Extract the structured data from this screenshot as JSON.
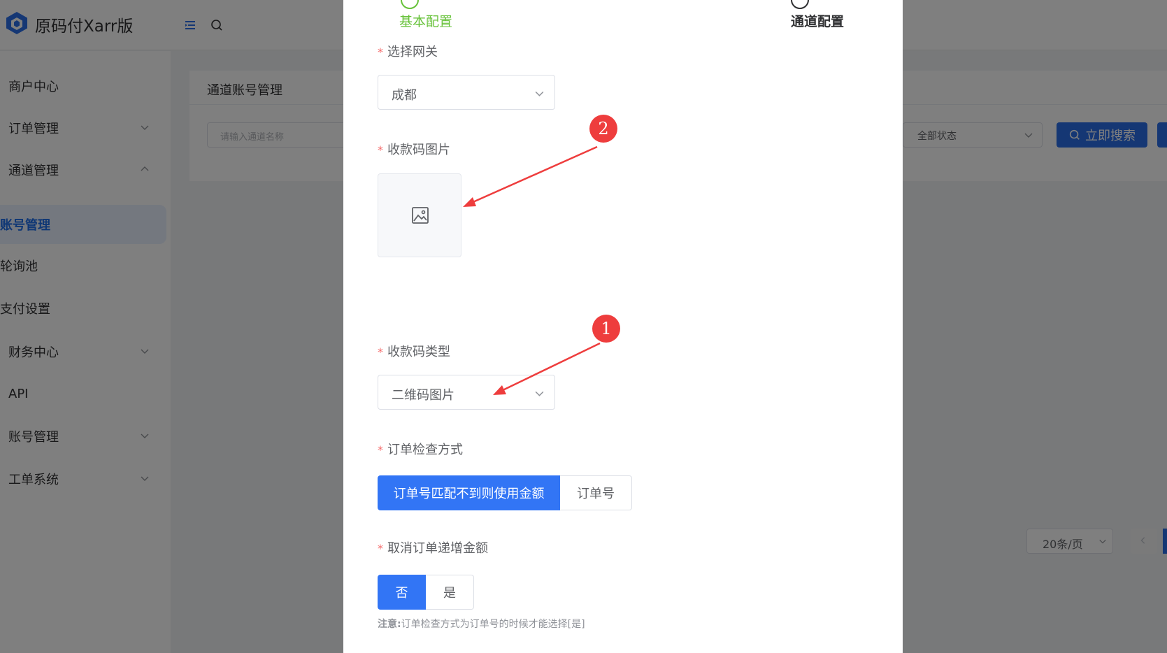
{
  "app": {
    "title": "原码付Xarr版"
  },
  "sidebar": {
    "items": [
      {
        "label": "商户中心",
        "expandable": false
      },
      {
        "label": "订单管理",
        "expandable": true,
        "expanded": false
      },
      {
        "label": "通道管理",
        "expandable": true,
        "expanded": true
      },
      {
        "label": "账号管理",
        "active": true
      },
      {
        "label": "轮询池"
      },
      {
        "label": "支付设置"
      },
      {
        "label": "财务中心",
        "expandable": true,
        "expanded": false
      },
      {
        "label": "API"
      },
      {
        "label": "账号管理",
        "expandable": true,
        "expanded": false
      },
      {
        "label": "工单系统",
        "expandable": true,
        "expanded": false
      }
    ]
  },
  "main": {
    "card_title": "通道账号管理",
    "search_placeholder": "请输入通道名称",
    "status_select": "全部状态",
    "search_button": "立即搜索",
    "page_size": "20条/页"
  },
  "dialog": {
    "steps": [
      {
        "label": "基本配置",
        "state": "done",
        "color": "#67c23a"
      },
      {
        "label": "通道配置",
        "state": "current",
        "color": "#303133"
      }
    ],
    "fields": {
      "gateway": {
        "label": "选择网关",
        "value": "成都"
      },
      "qr_image": {
        "label": "收款码图片"
      },
      "qr_type": {
        "label": "收款码类型",
        "value": "二维码图片"
      },
      "order_check": {
        "label": "订单检查方式",
        "options": [
          "订单号匹配不到则使用金额",
          "订单号"
        ],
        "selected": 0
      },
      "cancel_increment": {
        "label": "取消订单递增金额",
        "options": [
          "否",
          "是"
        ],
        "selected": 0
      }
    },
    "note_prefix": "注意:",
    "note_text": "订单检查方式为订单号的时候才能选择[是]"
  },
  "annotations": [
    {
      "number": "2"
    },
    {
      "number": "1"
    }
  ],
  "colors": {
    "primary": "#3275f5",
    "success": "#67c23a",
    "annotation": "#ee3d3d",
    "required": "#f56c6c"
  }
}
